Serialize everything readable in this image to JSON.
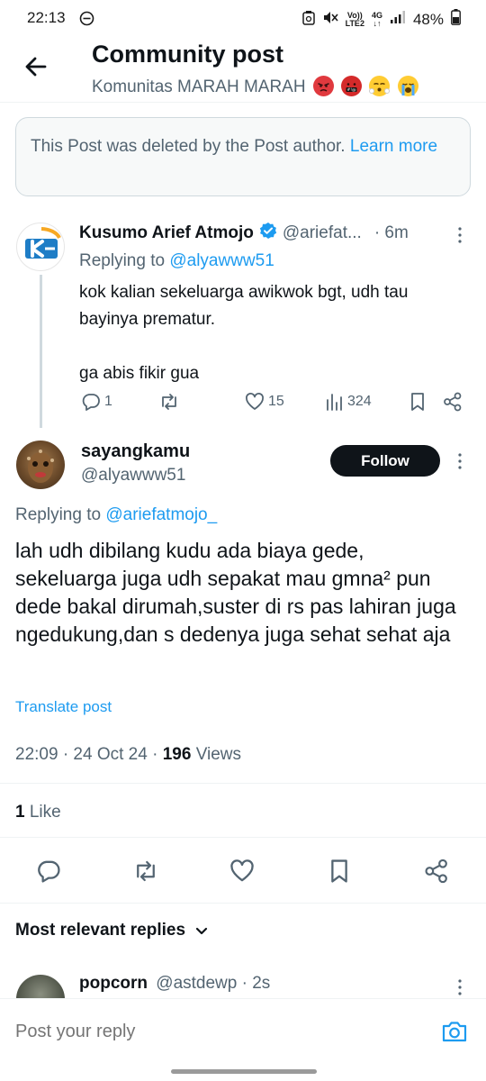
{
  "status_bar": {
    "time": "22:13",
    "network_top": "Vo))",
    "network_bottom": "LTE2",
    "net_gen": "4G",
    "battery": "48%"
  },
  "header": {
    "title": "Community post",
    "subtitle": "Komunitas MARAH MARAH"
  },
  "deleted_notice": {
    "text": "This Post was deleted by the Post author.",
    "link": "Learn more"
  },
  "reply_tweet": {
    "name": "Kusumo Arief Atmojo",
    "handle": "@ariefat...",
    "time": "· 6m",
    "replying_prefix": "Replying to",
    "replying_handle": "@alyawww51",
    "body": "kok kalian sekeluarga awikwok bgt, udh tau bayinya prematur.\n\nga abis fikir gua",
    "replies": "1",
    "likes": "15",
    "views": "324"
  },
  "main_post": {
    "name": "sayangkamu",
    "handle": "@alyawww51",
    "follow_label": "Follow",
    "replying_prefix": "Replying to",
    "replying_handle": "@ariefatmojo_",
    "body": "lah udh dibilang kudu ada biaya gede, sekeluarga juga udh sepakat mau gmna² pun dede bakal dirumah,suster di rs pas lahiran juga ngedukung,dan s dedenya juga sehat sehat aja",
    "translate": "Translate post",
    "timestamp": "22:09 · 24 Oct 24 ·",
    "views_count": "196",
    "views_label": "Views",
    "likes_count": "1",
    "likes_label": "Like"
  },
  "replies_section": {
    "sort_label": "Most relevant replies",
    "preview": {
      "name": "popcorn",
      "handle": "@astdewp",
      "time": "· 2s"
    }
  },
  "reply_bar": {
    "placeholder": "Post your reply"
  },
  "colors": {
    "accent": "#1d9bf0",
    "text": "#0f1419",
    "muted": "#536471",
    "verified": "#1d9bf0"
  }
}
